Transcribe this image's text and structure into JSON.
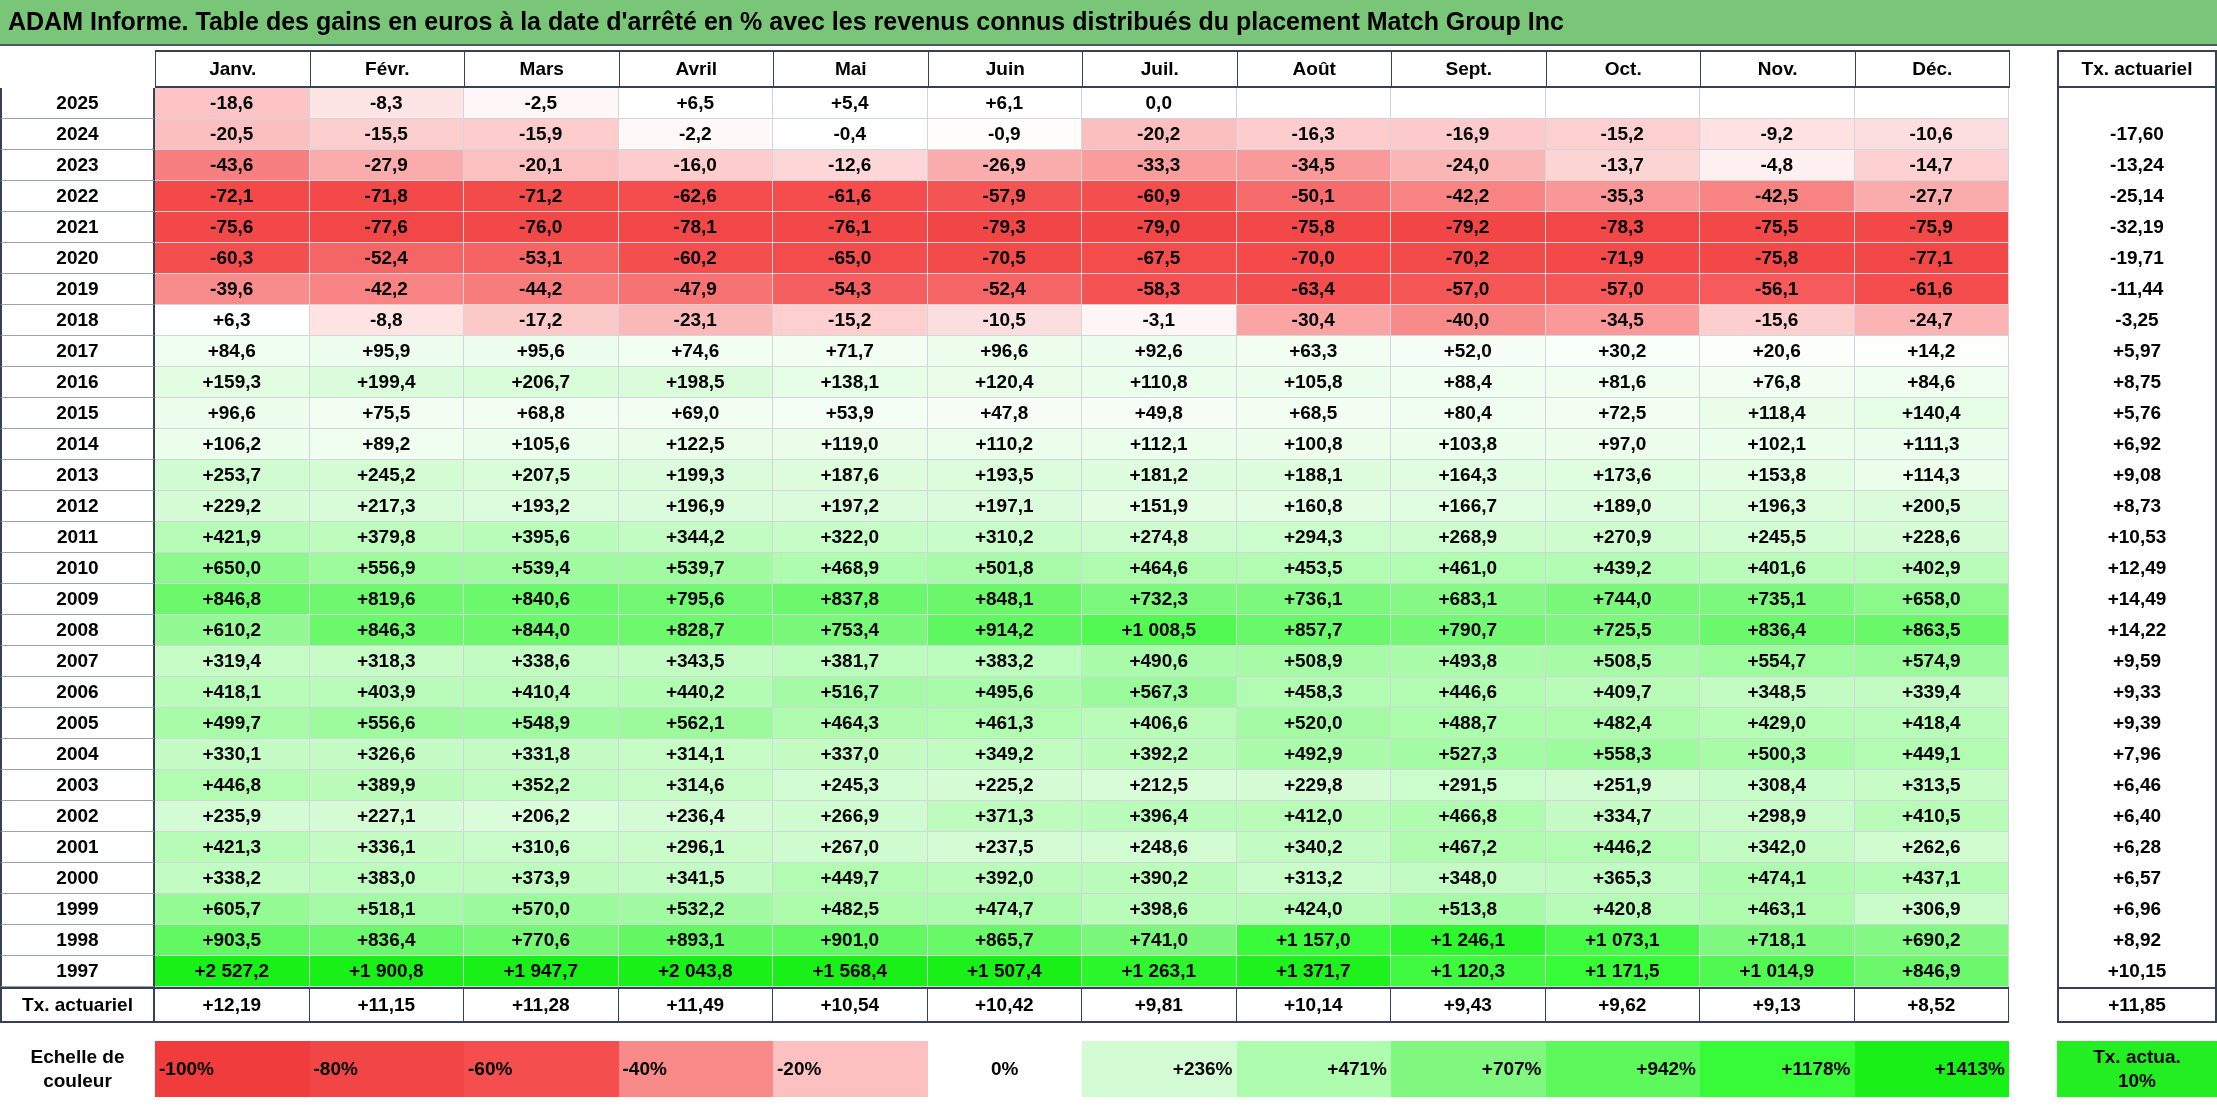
{
  "title": "ADAM Informe. Table des gains en euros à la date d'arrêté en % avec les revenus connus distribués du placement Match Group Inc",
  "columns": [
    "Janv.",
    "Févr.",
    "Mars",
    "Avril",
    "Mai",
    "Juin",
    "Juil.",
    "Août",
    "Sept.",
    "Oct.",
    "Nov.",
    "Déc."
  ],
  "total_column": "Tx. actuariel",
  "rows": [
    {
      "year": "2025",
      "values": [
        "-18,6",
        "-8,3",
        "-2,5",
        "+6,5",
        "+5,4",
        "+6,1",
        "0,0"
      ]
    },
    {
      "year": "2024",
      "values": [
        "-20,5",
        "-15,5",
        "-15,9",
        "-2,2",
        "-0,4",
        "-0,9",
        "-20,2",
        "-16,3",
        "-16,9",
        "-15,2",
        "-9,2",
        "-10,6"
      ],
      "total": "-17,60"
    },
    {
      "year": "2023",
      "values": [
        "-43,6",
        "-27,9",
        "-20,1",
        "-16,0",
        "-12,6",
        "-26,9",
        "-33,3",
        "-34,5",
        "-24,0",
        "-13,7",
        "-4,8",
        "-14,7"
      ],
      "total": "-13,24"
    },
    {
      "year": "2022",
      "values": [
        "-72,1",
        "-71,8",
        "-71,2",
        "-62,6",
        "-61,6",
        "-57,9",
        "-60,9",
        "-50,1",
        "-42,2",
        "-35,3",
        "-42,5",
        "-27,7"
      ],
      "total": "-25,14"
    },
    {
      "year": "2021",
      "values": [
        "-75,6",
        "-77,6",
        "-76,0",
        "-78,1",
        "-76,1",
        "-79,3",
        "-79,0",
        "-75,8",
        "-79,2",
        "-78,3",
        "-75,5",
        "-75,9"
      ],
      "total": "-32,19"
    },
    {
      "year": "2020",
      "values": [
        "-60,3",
        "-52,4",
        "-53,1",
        "-60,2",
        "-65,0",
        "-70,5",
        "-67,5",
        "-70,0",
        "-70,2",
        "-71,9",
        "-75,8",
        "-77,1"
      ],
      "total": "-19,71"
    },
    {
      "year": "2019",
      "values": [
        "-39,6",
        "-42,2",
        "-44,2",
        "-47,9",
        "-54,3",
        "-52,4",
        "-58,3",
        "-63,4",
        "-57,0",
        "-57,0",
        "-56,1",
        "-61,6"
      ],
      "total": "-11,44"
    },
    {
      "year": "2018",
      "values": [
        "+6,3",
        "-8,8",
        "-17,2",
        "-23,1",
        "-15,2",
        "-10,5",
        "-3,1",
        "-30,4",
        "-40,0",
        "-34,5",
        "-15,6",
        "-24,7"
      ],
      "total": "-3,25"
    },
    {
      "year": "2017",
      "values": [
        "+84,6",
        "+95,9",
        "+95,6",
        "+74,6",
        "+71,7",
        "+96,6",
        "+92,6",
        "+63,3",
        "+52,0",
        "+30,2",
        "+20,6",
        "+14,2"
      ],
      "total": "+5,97"
    },
    {
      "year": "2016",
      "values": [
        "+159,3",
        "+199,4",
        "+206,7",
        "+198,5",
        "+138,1",
        "+120,4",
        "+110,8",
        "+105,8",
        "+88,4",
        "+81,6",
        "+76,8",
        "+84,6"
      ],
      "total": "+8,75"
    },
    {
      "year": "2015",
      "values": [
        "+96,6",
        "+75,5",
        "+68,8",
        "+69,0",
        "+53,9",
        "+47,8",
        "+49,8",
        "+68,5",
        "+80,4",
        "+72,5",
        "+118,4",
        "+140,4"
      ],
      "total": "+5,76"
    },
    {
      "year": "2014",
      "values": [
        "+106,2",
        "+89,2",
        "+105,6",
        "+122,5",
        "+119,0",
        "+110,2",
        "+112,1",
        "+100,8",
        "+103,8",
        "+97,0",
        "+102,1",
        "+111,3"
      ],
      "total": "+6,92"
    },
    {
      "year": "2013",
      "values": [
        "+253,7",
        "+245,2",
        "+207,5",
        "+199,3",
        "+187,6",
        "+193,5",
        "+181,2",
        "+188,1",
        "+164,3",
        "+173,6",
        "+153,8",
        "+114,3"
      ],
      "total": "+9,08"
    },
    {
      "year": "2012",
      "values": [
        "+229,2",
        "+217,3",
        "+193,2",
        "+196,9",
        "+197,2",
        "+197,1",
        "+151,9",
        "+160,8",
        "+166,7",
        "+189,0",
        "+196,3",
        "+200,5"
      ],
      "total": "+8,73"
    },
    {
      "year": "2011",
      "values": [
        "+421,9",
        "+379,8",
        "+395,6",
        "+344,2",
        "+322,0",
        "+310,2",
        "+274,8",
        "+294,3",
        "+268,9",
        "+270,9",
        "+245,5",
        "+228,6"
      ],
      "total": "+10,53"
    },
    {
      "year": "2010",
      "values": [
        "+650,0",
        "+556,9",
        "+539,4",
        "+539,7",
        "+468,9",
        "+501,8",
        "+464,6",
        "+453,5",
        "+461,0",
        "+439,2",
        "+401,6",
        "+402,9"
      ],
      "total": "+12,49"
    },
    {
      "year": "2009",
      "values": [
        "+846,8",
        "+819,6",
        "+840,6",
        "+795,6",
        "+837,8",
        "+848,1",
        "+732,3",
        "+736,1",
        "+683,1",
        "+744,0",
        "+735,1",
        "+658,0"
      ],
      "total": "+14,49"
    },
    {
      "year": "2008",
      "values": [
        "+610,2",
        "+846,3",
        "+844,0",
        "+828,7",
        "+753,4",
        "+914,2",
        "+1 008,5",
        "+857,7",
        "+790,7",
        "+725,5",
        "+836,4",
        "+863,5"
      ],
      "total": "+14,22"
    },
    {
      "year": "2007",
      "values": [
        "+319,4",
        "+318,3",
        "+338,6",
        "+343,5",
        "+381,7",
        "+383,2",
        "+490,6",
        "+508,9",
        "+493,8",
        "+508,5",
        "+554,7",
        "+574,9"
      ],
      "total": "+9,59"
    },
    {
      "year": "2006",
      "values": [
        "+418,1",
        "+403,9",
        "+410,4",
        "+440,2",
        "+516,7",
        "+495,6",
        "+567,3",
        "+458,3",
        "+446,6",
        "+409,7",
        "+348,5",
        "+339,4"
      ],
      "total": "+9,33"
    },
    {
      "year": "2005",
      "values": [
        "+499,7",
        "+556,6",
        "+548,9",
        "+562,1",
        "+464,3",
        "+461,3",
        "+406,6",
        "+520,0",
        "+488,7",
        "+482,4",
        "+429,0",
        "+418,4"
      ],
      "total": "+9,39"
    },
    {
      "year": "2004",
      "values": [
        "+330,1",
        "+326,6",
        "+331,8",
        "+314,1",
        "+337,0",
        "+349,2",
        "+392,2",
        "+492,9",
        "+527,3",
        "+558,3",
        "+500,3",
        "+449,1"
      ],
      "total": "+7,96"
    },
    {
      "year": "2003",
      "values": [
        "+446,8",
        "+389,9",
        "+352,2",
        "+314,6",
        "+245,3",
        "+225,2",
        "+212,5",
        "+229,8",
        "+291,5",
        "+251,9",
        "+308,4",
        "+313,5"
      ],
      "total": "+6,46"
    },
    {
      "year": "2002",
      "values": [
        "+235,9",
        "+227,1",
        "+206,2",
        "+236,4",
        "+266,9",
        "+371,3",
        "+396,4",
        "+412,0",
        "+466,8",
        "+334,7",
        "+298,9",
        "+410,5"
      ],
      "total": "+6,40"
    },
    {
      "year": "2001",
      "values": [
        "+421,3",
        "+336,1",
        "+310,6",
        "+296,1",
        "+267,0",
        "+237,5",
        "+248,6",
        "+340,2",
        "+467,2",
        "+446,2",
        "+342,0",
        "+262,6"
      ],
      "total": "+6,28"
    },
    {
      "year": "2000",
      "values": [
        "+338,2",
        "+383,0",
        "+373,9",
        "+341,5",
        "+449,7",
        "+392,0",
        "+390,2",
        "+313,2",
        "+348,0",
        "+365,3",
        "+474,1",
        "+437,1"
      ],
      "total": "+6,57"
    },
    {
      "year": "1999",
      "values": [
        "+605,7",
        "+518,1",
        "+570,0",
        "+532,2",
        "+482,5",
        "+474,7",
        "+398,6",
        "+424,0",
        "+513,8",
        "+420,8",
        "+463,1",
        "+306,9"
      ],
      "total": "+6,96"
    },
    {
      "year": "1998",
      "values": [
        "+903,5",
        "+836,4",
        "+770,6",
        "+893,1",
        "+901,0",
        "+865,7",
        "+741,0",
        "+1 157,0",
        "+1 246,1",
        "+1 073,1",
        "+718,1",
        "+690,2"
      ],
      "total": "+8,92"
    },
    {
      "year": "1997",
      "values": [
        "+2 527,2",
        "+1 900,8",
        "+1 947,7",
        "+2 043,8",
        "+1 568,4",
        "+1 507,4",
        "+1 263,1",
        "+1 371,7",
        "+1 120,3",
        "+1 171,5",
        "+1 014,9",
        "+846,9"
      ],
      "total": "+10,15"
    }
  ],
  "footer": {
    "label": "Tx. actuariel",
    "values": [
      "+12,19",
      "+11,15",
      "+11,28",
      "+11,49",
      "+10,54",
      "+10,42",
      "+9,81",
      "+10,14",
      "+9,43",
      "+9,62",
      "+9,13",
      "+8,52"
    ],
    "total": "+11,85"
  },
  "legend": {
    "label": "Echelle de couleur",
    "stops": [
      {
        "label": "-100%",
        "color": "#f03c3c"
      },
      {
        "label": "-80%",
        "color": "#f24646"
      },
      {
        "label": "-60%",
        "color": "#f54e4e"
      },
      {
        "label": "-40%",
        "color": "#f88a8a"
      },
      {
        "label": "-20%",
        "color": "#fcc0c0"
      },
      {
        "label": "0%",
        "color": "#ffffff"
      },
      {
        "label": "+236%",
        "color": "#d4fcd4"
      },
      {
        "label": "+471%",
        "color": "#aefcae"
      },
      {
        "label": "+707%",
        "color": "#80f880"
      },
      {
        "label": "+942%",
        "color": "#5cf85c"
      },
      {
        "label": "+1178%",
        "color": "#36fb36"
      },
      {
        "label": "+1413%",
        "color": "#18f018"
      }
    ],
    "total_stop": {
      "label": "Tx. actua. 10%",
      "color": "#22ee22"
    }
  }
}
